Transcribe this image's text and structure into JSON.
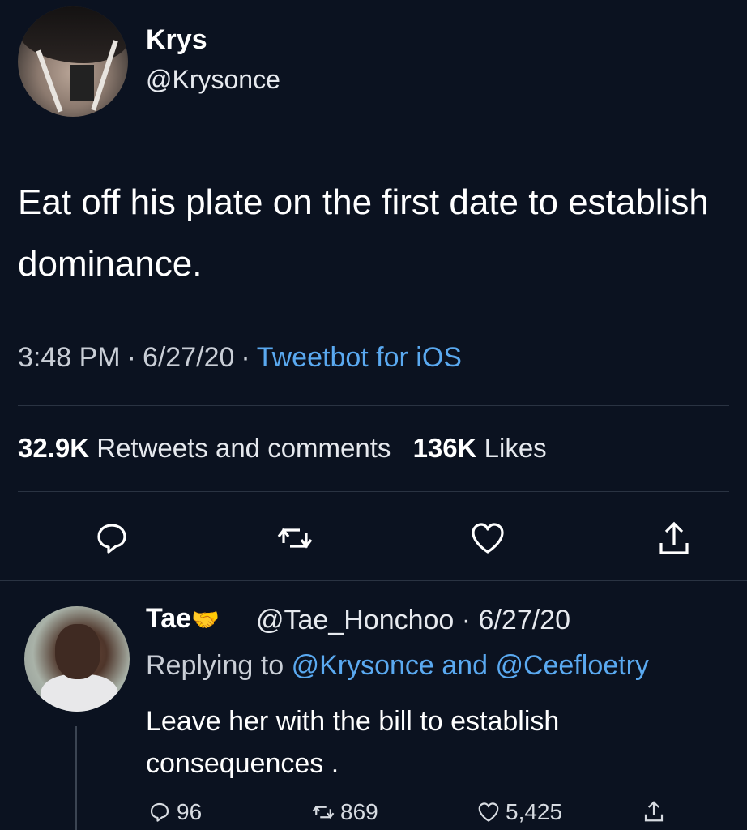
{
  "main_tweet": {
    "display_name": "Krys",
    "handle": "@Krysonce",
    "text": "Eat off his plate on the first date to establish dominance.",
    "time": "3:48 PM",
    "date": "6/27/20",
    "separator": "·",
    "client": "Tweetbot for iOS",
    "retweets_count": "32.9K",
    "retweets_label": "Retweets and comments",
    "likes_count": "136K",
    "likes_label": "Likes",
    "actions": [
      "reply-icon",
      "retweet-icon",
      "like-icon",
      "share-icon"
    ]
  },
  "reply_tweet": {
    "display_name": "Tae",
    "name_emoji": "🤝",
    "handle_date": "@Tae_Honchoo · 6/27/20",
    "replying_prefix": "Replying to",
    "mention_1": "@Krysonce",
    "and_word": "and",
    "mention_2": "@Ceefloetry",
    "text": "Leave her with the bill to establish consequences .",
    "replies": "96",
    "retweets": "869",
    "likes": "5,425"
  },
  "colors": {
    "background": "#0b1220",
    "link": "#5aa9f0",
    "muted": "#c9ced6",
    "divider": "#2a3342"
  }
}
